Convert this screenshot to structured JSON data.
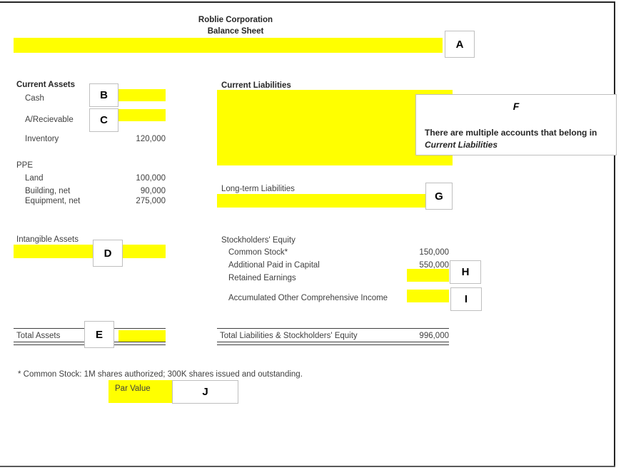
{
  "document": {
    "company": "Roblie Corporation",
    "statement": "Balance Sheet"
  },
  "assets": {
    "current_assets_heading": "Current Assets",
    "rows": [
      {
        "label": "Cash",
        "value": "",
        "blank": "B"
      },
      {
        "label": "A/Recievable",
        "value": "",
        "blank": "C"
      },
      {
        "label": "Inventory",
        "value": "120,000",
        "blank": ""
      }
    ],
    "ppe_heading": "PPE",
    "ppe_rows": [
      {
        "label": "Land",
        "value": "100,000"
      },
      {
        "label": "Building, net",
        "value": "90,000"
      },
      {
        "label": "Equipment, net",
        "value": "275,000"
      }
    ],
    "intangible_heading": "Intangible Assets",
    "intangible_blank": "D",
    "total_label": "Total Assets",
    "total_value": "",
    "total_blank": "E"
  },
  "liabilities": {
    "current_liabilities_heading": "Current Liabilities",
    "current_liabilities_blank": "",
    "long_term_heading": "Long-term Liabilities",
    "long_term_blank": "G"
  },
  "equity": {
    "heading": "Stockholders' Equity",
    "rows": [
      {
        "label": "Common Stock*",
        "value": "150,000",
        "blank": ""
      },
      {
        "label": "Additional Paid in Capital",
        "value": "550,000",
        "blank": ""
      },
      {
        "label": "Retained Earnings",
        "value": "",
        "blank": "H"
      },
      {
        "label": "Accumulated Other Comprehensive Income",
        "value": "",
        "blank": "I"
      }
    ],
    "total_label": "Total Liabilities & Stockholders' Equity",
    "total_value": "996,000"
  },
  "callouts": {
    "a": "A",
    "b": "B",
    "c": "C",
    "d": "D",
    "e": "E",
    "g": "G",
    "h": "H",
    "i": "I",
    "j": "J",
    "f_letter": "F",
    "f_text_plain": "There are multiple accounts that belong in ",
    "f_text_italic": "Current Liabilities"
  },
  "footnote": {
    "text": "* Common Stock:  1M shares authorized; 300K shares issued and outstanding.",
    "par_value_label": "Par Value",
    "par_value_blank": "J"
  },
  "colors": {
    "highlight": "#ffff00",
    "text": "#404040",
    "heading": "#262626",
    "box_border": "#bfbfbf"
  }
}
